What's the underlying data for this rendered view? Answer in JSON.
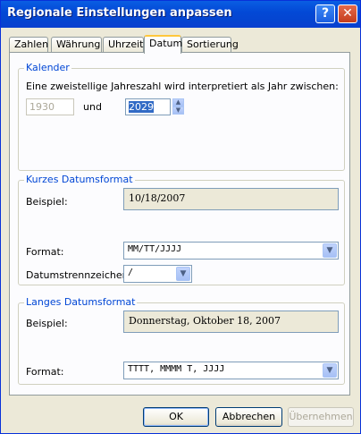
{
  "window": {
    "title": "Regionale Einstellungen anpassen",
    "help_glyph": "?",
    "close_glyph": "✕"
  },
  "tabs": [
    {
      "label": "Zahlen"
    },
    {
      "label": "Währung"
    },
    {
      "label": "Uhrzeit"
    },
    {
      "label": "Datum",
      "active": true
    },
    {
      "label": "Sortierung"
    }
  ],
  "calendar": {
    "group_label": "Kalender",
    "description": "Eine zweistellige Jahreszahl wird interpretiert als Jahr zwischen:",
    "from_year": "1930",
    "and_label": "und",
    "to_year": "2029"
  },
  "short_date": {
    "group_label": "Kurzes Datumsformat",
    "example_label": "Beispiel:",
    "example_value": "10/18/2007",
    "format_label": "Format:",
    "format_value": "MM/TT/JJJJ",
    "separator_label": "Datumstrennzeichen:",
    "separator_value": "/"
  },
  "long_date": {
    "group_label": "Langes Datumsformat",
    "example_label": "Beispiel:",
    "example_value": "Donnerstag,  Oktober 18, 2007",
    "format_label": "Format:",
    "format_value": "TTTT,  MMMM T, JJJJ"
  },
  "buttons": {
    "ok": "OK",
    "cancel": "Abbrechen",
    "apply": "Übernehmen"
  },
  "icons": {
    "dropdown": "▼",
    "spin_up": "▲",
    "spin_down": "▼"
  },
  "colors": {
    "title_bar": "#0349d6",
    "group_label": "#0046d5",
    "active_tab_accent": "#ffc73c"
  }
}
